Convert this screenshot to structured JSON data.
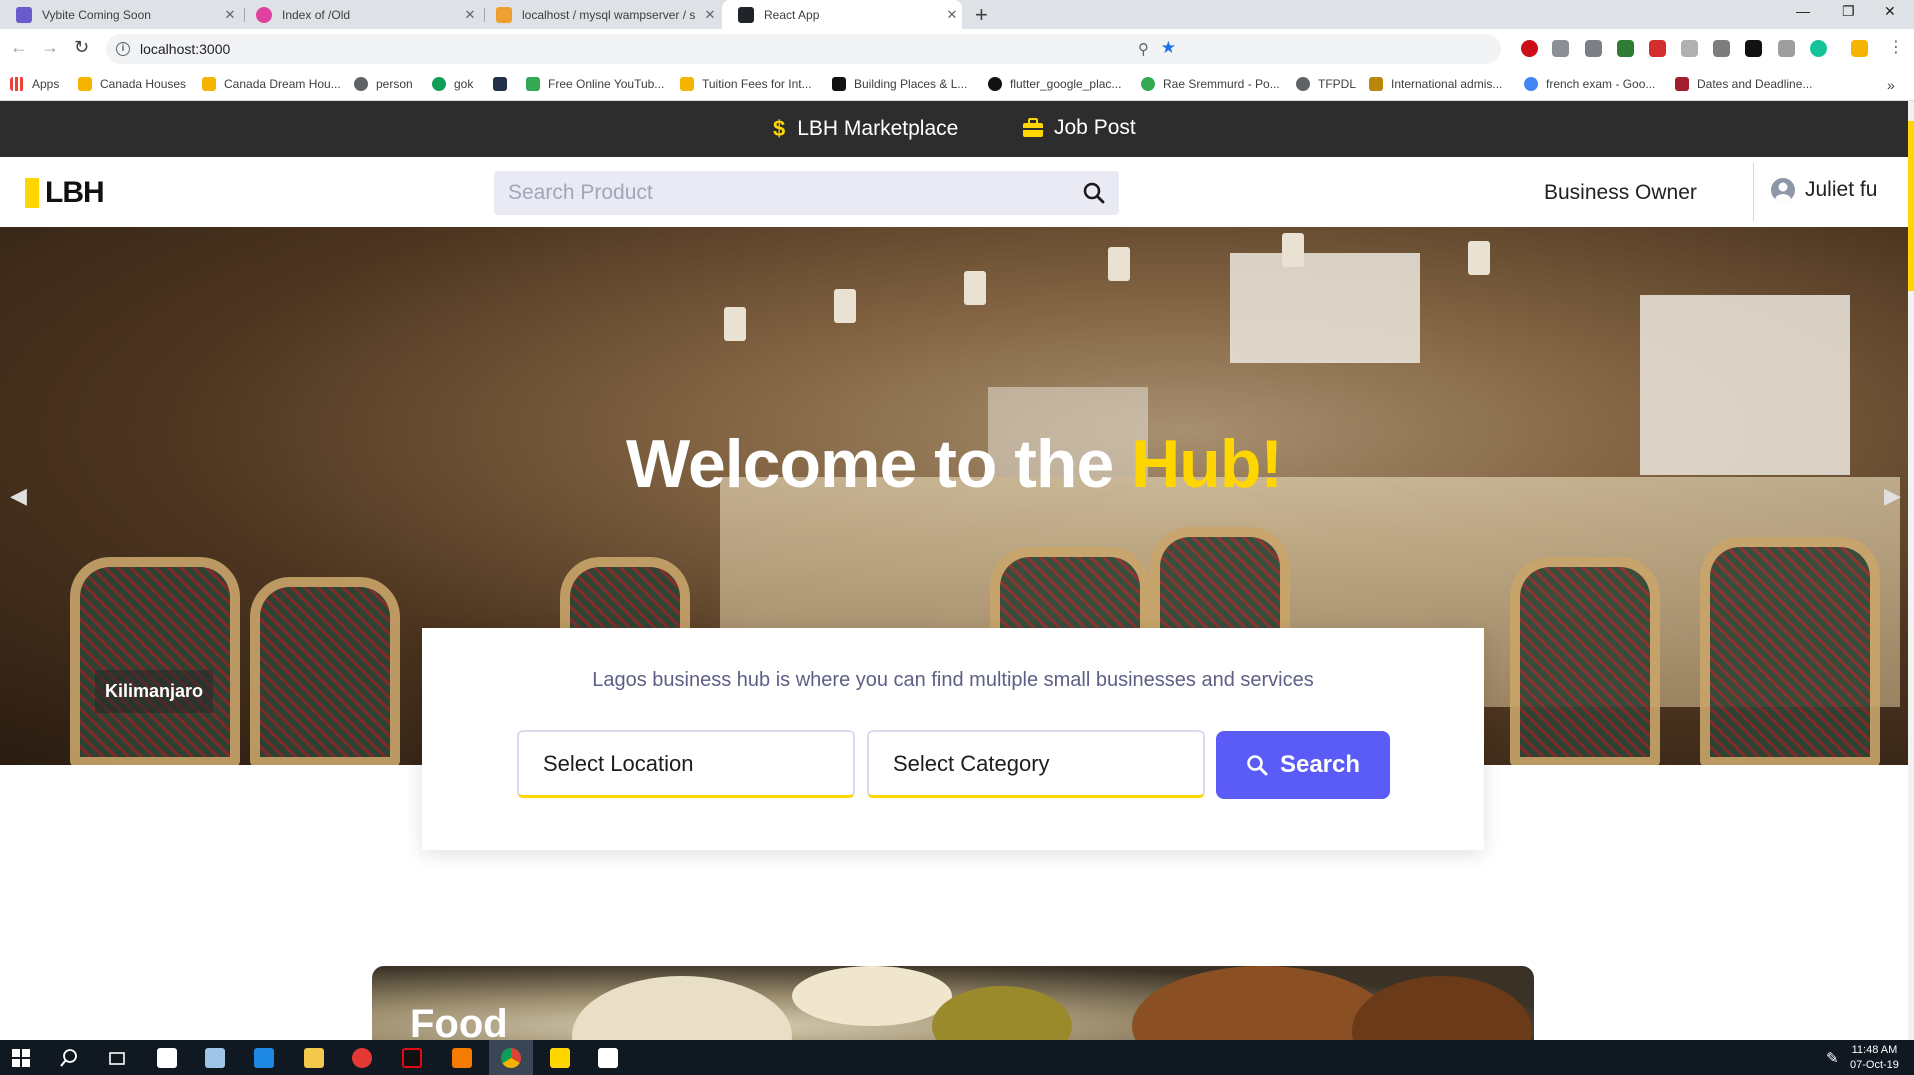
{
  "browser": {
    "tabs": [
      {
        "title": "Vybite Coming Soon",
        "icon_color": "#6a5acd",
        "active": false
      },
      {
        "title": "Index of /Old",
        "icon_color": "#e040a0",
        "active": false
      },
      {
        "title": "localhost / mysql wampserver / s",
        "icon_color": "#f0a030",
        "active": false
      },
      {
        "title": "React App",
        "icon_color": "#20232a",
        "active": true
      }
    ],
    "url": "localhost:3000",
    "bookmarks": [
      {
        "label": "Apps",
        "icon": "apps-grid-icon",
        "icon_color": "#e94235"
      },
      {
        "label": "Canada Houses",
        "icon": "house-icon",
        "icon_color": "#f4b400"
      },
      {
        "label": "Canada Dream Hou...",
        "icon": "house-icon",
        "icon_color": "#f4b400"
      },
      {
        "label": "person",
        "icon": "globe-icon",
        "icon_color": "#5f6368"
      },
      {
        "label": "gok",
        "icon": "g-icon",
        "icon_color": "#0f9d58"
      },
      {
        "label": "",
        "icon": "atom-icon",
        "icon_color": "#24314d"
      },
      {
        "label": "Free Online YouTub...",
        "icon": "download-icon",
        "icon_color": "#34a853"
      },
      {
        "label": "Tuition Fees for Int...",
        "icon": "school-icon",
        "icon_color": "#f4b400"
      },
      {
        "label": "Building Places & L...",
        "icon": "medium-icon",
        "icon_color": "#111111"
      },
      {
        "label": "flutter_google_plac...",
        "icon": "github-icon",
        "icon_color": "#111111"
      },
      {
        "label": "Rae Sremmurd - Po...",
        "icon": "music-icon",
        "icon_color": "#34a853"
      },
      {
        "label": "TFPDL",
        "icon": "globe-icon",
        "icon_color": "#5f6368"
      },
      {
        "label": "International admis...",
        "icon": "shield-icon",
        "icon_color": "#b8860b"
      },
      {
        "label": "french exam - Goo...",
        "icon": "google-icon",
        "icon_color": "#4285f4"
      },
      {
        "label": "Dates and Deadline...",
        "icon": "crest-icon",
        "icon_color": "#a01e2e"
      }
    ]
  },
  "site": {
    "promo": {
      "marketplace_label": "LBH Marketplace",
      "jobpost_label": "Job Post"
    },
    "header": {
      "logo_text": "LBH",
      "search_placeholder": "Search Product",
      "business_owner_label": "Business Owner",
      "user_name": "Juliet fu"
    },
    "hero": {
      "title_prefix": "Welcome to the ",
      "title_highlight": "Hub!",
      "slide_caption": "Kilimanjaro"
    },
    "search_card": {
      "subtitle": "Lagos business hub is where you can find multiple small businesses and services",
      "location_label": "Select Location",
      "category_label": "Select Category",
      "search_label": "Search"
    },
    "categories": [
      {
        "title": "Food"
      }
    ]
  },
  "taskbar": {
    "time": "11:48 AM",
    "date": "07-Oct-19"
  },
  "colors": {
    "accent_yellow": "#ffd600",
    "primary_blue": "#5b5bf7",
    "topbar_dark": "#2d2d2d"
  }
}
